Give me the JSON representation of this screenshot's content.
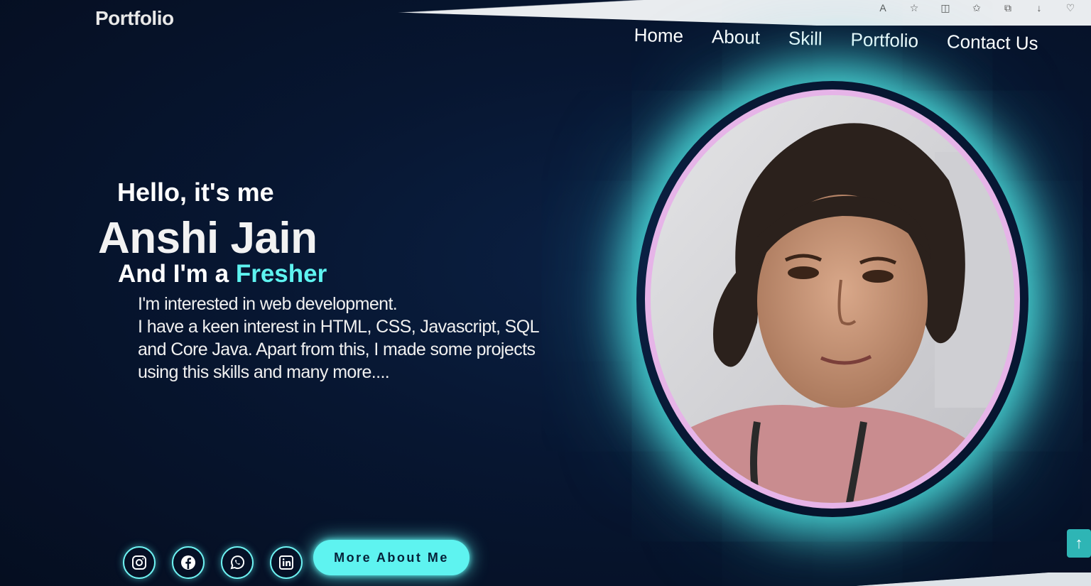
{
  "navbar": {
    "logo": "Portfolio",
    "links": [
      {
        "label": "Home"
      },
      {
        "label": "About"
      },
      {
        "label": "Skill"
      },
      {
        "label": "Portfolio"
      },
      {
        "label": "Contact Us"
      }
    ]
  },
  "hero": {
    "greeting": "Hello, it's me",
    "name": "Anshi Jain",
    "role_prefix": "And I'm a ",
    "role": "Fresher",
    "description_lines": [
      "I'm interested in web development.",
      "I have a keen interest in HTML, CSS, Javascript, SQL",
      "and Core Java. Apart from this, I made some projects",
      "using this skills and many more...."
    ],
    "more_button": "More About Me"
  },
  "socials": [
    {
      "icon": "instagram-icon"
    },
    {
      "icon": "facebook-icon"
    },
    {
      "icon": "whatsapp-icon"
    },
    {
      "icon": "linkedin-icon"
    }
  ],
  "colors": {
    "background": "#061226",
    "accent": "#5ef3f0",
    "profile_border": "#e6b4e8"
  },
  "scroll_top_icon": "arrow-up-icon"
}
